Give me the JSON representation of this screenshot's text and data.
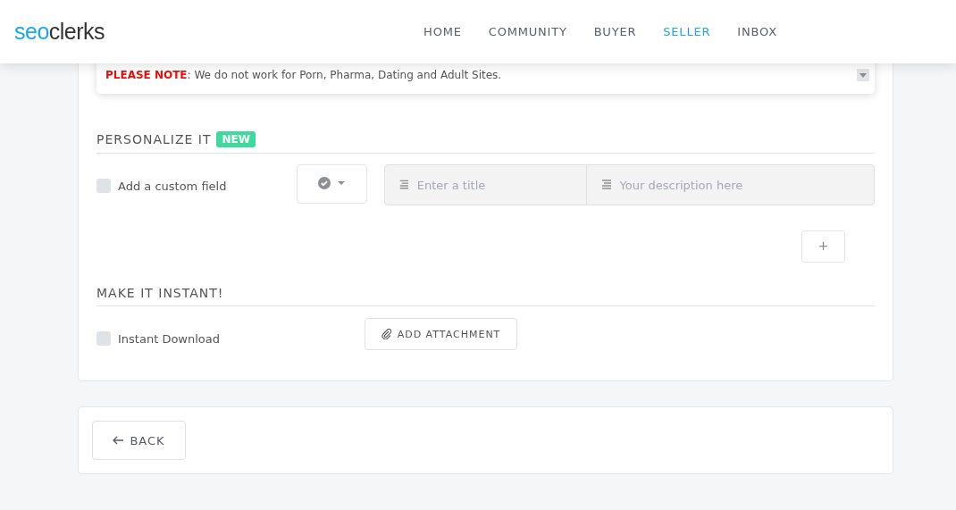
{
  "header": {
    "logo": {
      "part_1": "seo",
      "part_2": "clerks"
    },
    "nav": [
      {
        "label": "HOME",
        "selected": false
      },
      {
        "label": "COMMUNITY",
        "selected": false
      },
      {
        "label": "BUYER",
        "selected": false
      },
      {
        "label": "SELLER",
        "selected": true
      },
      {
        "label": "INBOX",
        "selected": false
      }
    ]
  },
  "note": {
    "label": "PLEASE NOTE",
    "text": ": We do not work for Porn, Pharma, Dating and Adult Sites."
  },
  "personalize": {
    "heading": "PERSONALIZE IT",
    "badge": "NEW",
    "checkbox": {
      "label": "Add a custom field",
      "checked": false
    },
    "title_placeholder": "Enter a title",
    "description_placeholder": "Your description here",
    "add_button": "+"
  },
  "instant": {
    "heading": "MAKE IT INSTANT!",
    "checkbox": {
      "label": "Instant Download",
      "checked": false
    },
    "attachment_button": "ADD ATTACHMENT"
  },
  "back_button": "BACK"
}
